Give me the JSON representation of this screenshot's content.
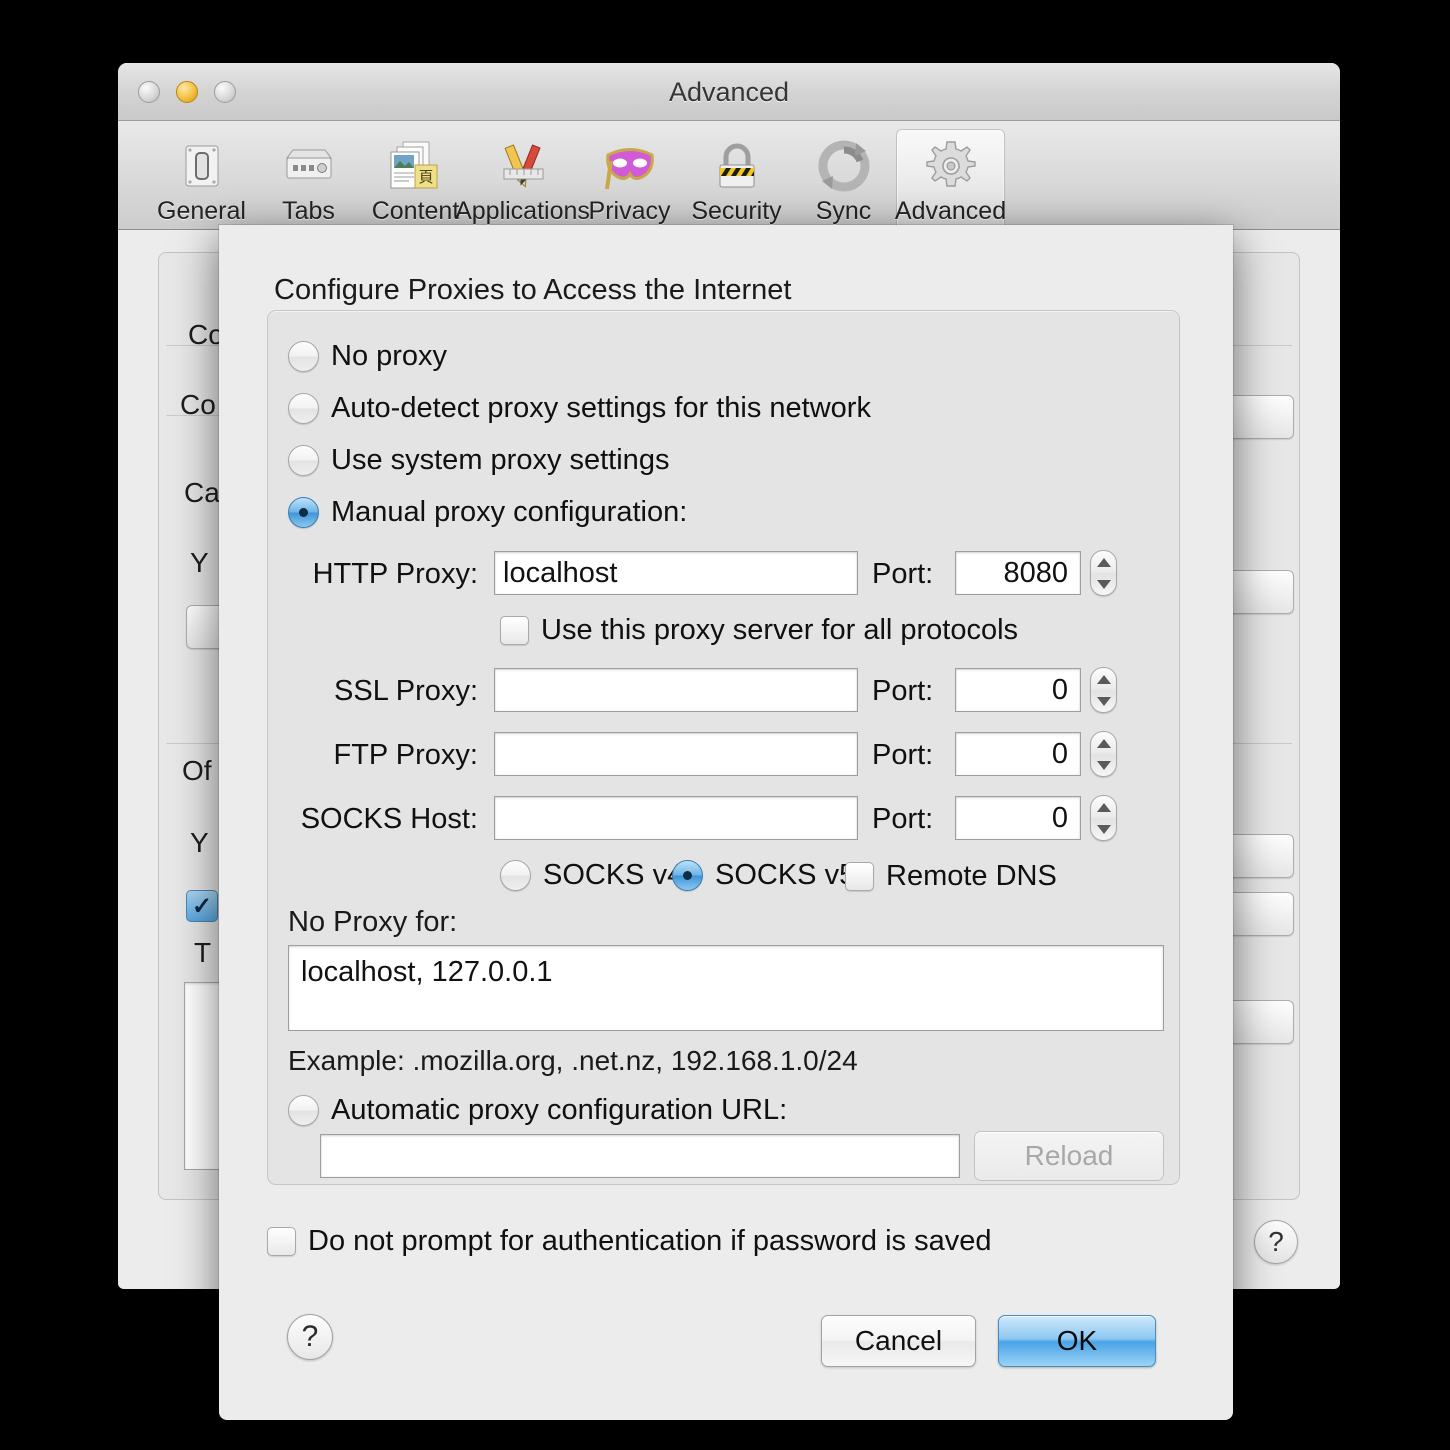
{
  "window": {
    "title": "Advanced",
    "controls": {
      "close": "close-button",
      "minimize": "minimize-button",
      "zoom": "zoom-button"
    }
  },
  "toolbar": {
    "items": [
      {
        "label": "General",
        "icon": "general-switch-icon"
      },
      {
        "label": "Tabs",
        "icon": "tabs-icon"
      },
      {
        "label": "Content",
        "icon": "content-documents-icon"
      },
      {
        "label": "Applications",
        "icon": "applications-pencil-ruler-icon"
      },
      {
        "label": "Privacy",
        "icon": "privacy-mask-icon"
      },
      {
        "label": "Security",
        "icon": "security-padlock-icon"
      },
      {
        "label": "Sync",
        "icon": "sync-arrows-icon"
      },
      {
        "label": "Advanced",
        "icon": "advanced-gear-icon"
      }
    ],
    "selected": "Advanced"
  },
  "background_pane": {
    "labels": [
      "Co",
      "Co",
      "Ca",
      "Y",
      "Of",
      "Y",
      "T"
    ],
    "help_label": "?"
  },
  "sheet": {
    "title": "Configure Proxies to Access the Internet",
    "proxy_modes": [
      {
        "label": "No proxy",
        "selected": false
      },
      {
        "label": "Auto-detect proxy settings for this network",
        "selected": false
      },
      {
        "label": "Use system proxy settings",
        "selected": false
      },
      {
        "label": "Manual proxy configuration:",
        "selected": true
      }
    ],
    "manual": {
      "rows": [
        {
          "label": "HTTP Proxy:",
          "value": "localhost",
          "port_label": "Port:",
          "port": "8080"
        },
        {
          "label": "SSL Proxy:",
          "value": "",
          "port_label": "Port:",
          "port": "0"
        },
        {
          "label": "FTP Proxy:",
          "value": "",
          "port_label": "Port:",
          "port": "0"
        },
        {
          "label": "SOCKS Host:",
          "value": "",
          "port_label": "Port:",
          "port": "0"
        }
      ],
      "share_all_protocols": {
        "label": "Use this proxy server for all protocols",
        "checked": false
      },
      "socks_version": [
        {
          "label": "SOCKS v4",
          "selected": false
        },
        {
          "label": "SOCKS v5",
          "selected": true
        }
      ],
      "remote_dns": {
        "label": "Remote DNS",
        "checked": false
      }
    },
    "no_proxy": {
      "label": "No Proxy for:",
      "value": "localhost, 127.0.0.1",
      "example": "Example: .mozilla.org, .net.nz, 192.168.1.0/24"
    },
    "auto_config": {
      "label": "Automatic proxy configuration URL:",
      "selected": false,
      "url": "",
      "reload_label": "Reload"
    },
    "no_prompt": {
      "label": "Do not prompt for authentication if password is saved",
      "checked": false
    },
    "footer": {
      "help_label": "?",
      "cancel_label": "Cancel",
      "ok_label": "OK"
    }
  },
  "colors": {
    "accent_blue": "#4aa3e6",
    "window_bg": "#ececec",
    "group_bg": "#e4e4e4"
  }
}
